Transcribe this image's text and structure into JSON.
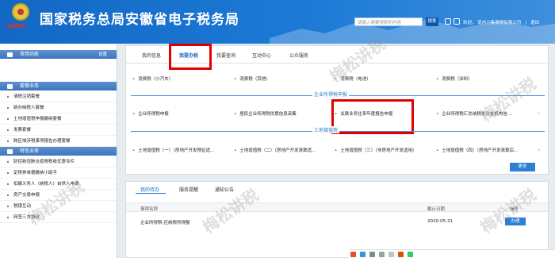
{
  "header": {
    "title": "国家税务总局安徽省电子税务局",
    "emblem_text": "中国税务",
    "search_placeholder": "请输入需要搜索的内容",
    "search_button": "搜索",
    "welcome": "欢迎，    亳州力集商贸有限公司",
    "logout": "退出",
    "bg_color": "#1c7ad6"
  },
  "sidebar": {
    "sections": [
      {
        "label": "常用功能",
        "action": "设置",
        "items": []
      },
      {
        "label": "套餐业务",
        "items": [
          "清税注销套餐",
          "新办纳税人套餐",
          "土地增值税申报缴纳套餐",
          "发票套餐",
          "跨区域涉税事项报告办理套餐"
        ]
      },
      {
        "label": "特色业务",
        "items": [
          "防控新冠肺炎疫情税收优惠专栏",
          "定税券单据缴纳小助手",
          "扣缴义务人（纳税人）自然人申请",
          "房产交易申报",
          "税银互动",
          "网签三方协议"
        ]
      }
    ]
  },
  "tabs": [
    "我的信息",
    "我要办税",
    "我要查询",
    "互动中心",
    "公众服务"
  ],
  "active_tab": "我要办税",
  "consumption_row": [
    "消费税（小汽车）",
    "消费税（其他）",
    "消费税（电池）",
    "消费税（涂料）"
  ],
  "sections": [
    {
      "label": "企业所得税申报",
      "items": [
        "企业所得税申报",
        "居民企业所得税优惠信息采集",
        "关联业务往来年度报告申报",
        "企业所得税汇总纳税总分支机构信..."
      ]
    },
    {
      "label": "土地增值税",
      "items": [
        "土地增值税（一）（房地产开发预征适...",
        "土地增值税（二）（房地产开发清算适...",
        "土地增值税（三）（非房地产开发适用）",
        "土地增值税（四）（房地产开发清算后..."
      ]
    }
  ],
  "more_button": "更多",
  "todo": {
    "tabs": [
      "我的待办",
      "服务提醒",
      "通知公告"
    ],
    "columns": [
      "事项名称",
      "截止日期",
      "操作"
    ],
    "rows": [
      {
        "name": "企业所得税-应纳税所得额",
        "deadline": "2020-05-31",
        "action": "办理"
      }
    ]
  },
  "watermark": "梅松讲税",
  "highlight_color": "#e00000"
}
